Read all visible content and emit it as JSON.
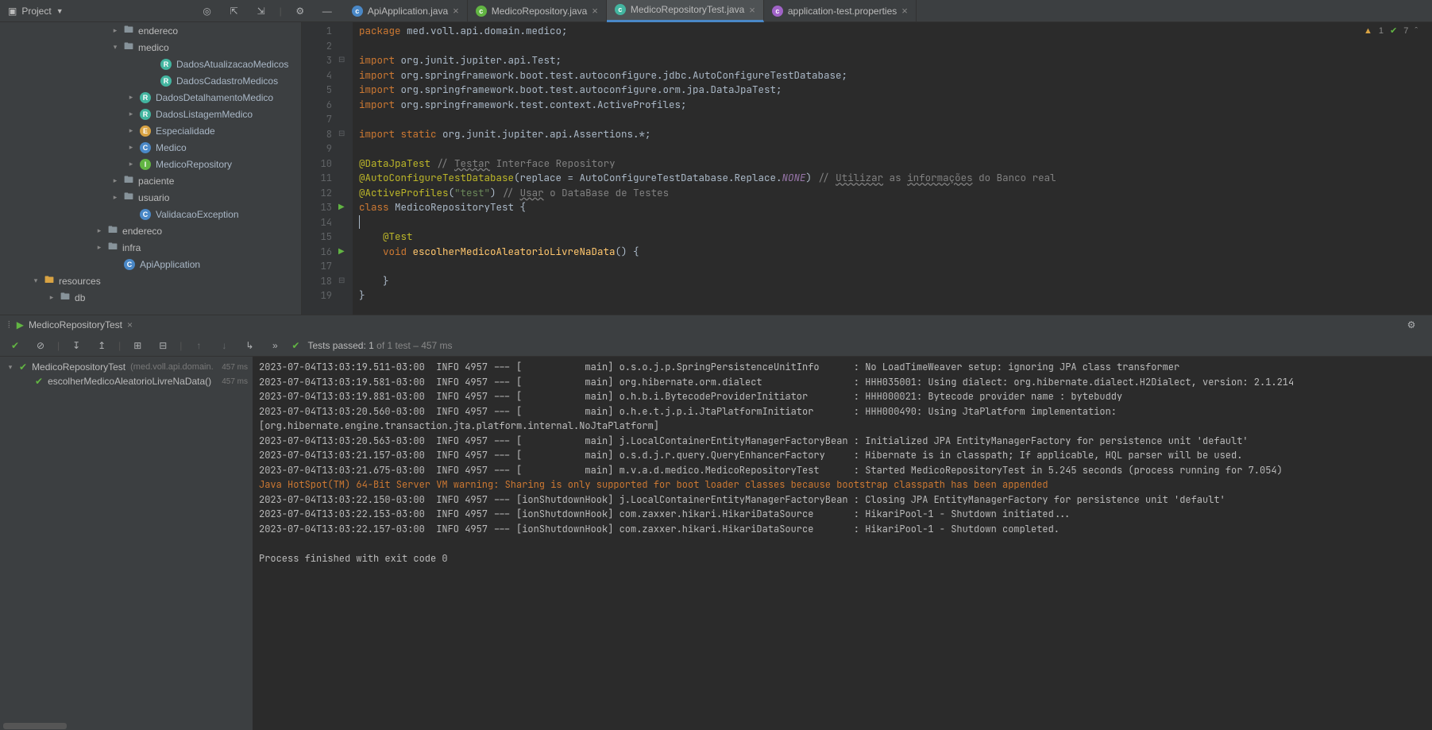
{
  "toolbar": {
    "project_label": "Project"
  },
  "tabs": [
    {
      "icon": "ic-blue",
      "label": "ApiApplication.java",
      "active": false
    },
    {
      "icon": "ic-green",
      "label": "MedicoRepository.java",
      "active": false
    },
    {
      "icon": "ic-teal",
      "label": "MedicoRepositoryTest.java",
      "active": true
    },
    {
      "icon": "ic-purp",
      "label": "application-test.properties",
      "active": false
    }
  ],
  "tree": [
    {
      "indent": 140,
      "chev": "▸",
      "type": "folder",
      "label": "endereco"
    },
    {
      "indent": 140,
      "chev": "▾",
      "type": "folder",
      "label": "medico"
    },
    {
      "indent": 186,
      "chev": "",
      "type": "rec",
      "label": "DadosAtualizacaoMedicos"
    },
    {
      "indent": 186,
      "chev": "",
      "type": "rec",
      "label": "DadosCadastroMedicos"
    },
    {
      "indent": 160,
      "chev": "▸",
      "type": "rec",
      "label": "DadosDetalhamentoMedico"
    },
    {
      "indent": 160,
      "chev": "▸",
      "type": "rec",
      "label": "DadosListagemMedico"
    },
    {
      "indent": 160,
      "chev": "▸",
      "type": "enum",
      "label": "Especialidade"
    },
    {
      "indent": 160,
      "chev": "▸",
      "type": "class",
      "label": "Medico"
    },
    {
      "indent": 160,
      "chev": "▸",
      "type": "iface",
      "label": "MedicoRepository"
    },
    {
      "indent": 140,
      "chev": "▸",
      "type": "folder",
      "label": "paciente"
    },
    {
      "indent": 140,
      "chev": "▸",
      "type": "folder",
      "label": "usuario"
    },
    {
      "indent": 160,
      "chev": "",
      "type": "class",
      "label": "ValidacaoException"
    },
    {
      "indent": 120,
      "chev": "▸",
      "type": "folder",
      "label": "endereco"
    },
    {
      "indent": 120,
      "chev": "▸",
      "type": "folder",
      "label": "infra"
    },
    {
      "indent": 140,
      "chev": "",
      "type": "class",
      "label": "ApiApplication"
    },
    {
      "indent": 40,
      "chev": "▾",
      "type": "resfolder",
      "label": "resources"
    },
    {
      "indent": 60,
      "chev": "▸",
      "type": "folder",
      "label": "db"
    }
  ],
  "warnings": {
    "warn_count": "1",
    "ok_count": "7"
  },
  "code_lines": [
    {
      "n": "1",
      "html": "<span class='kw'>package </span>med.voll.api.domain.medico;"
    },
    {
      "n": "2",
      "html": ""
    },
    {
      "n": "3",
      "html": "<span class='kw'>import </span>org.junit.jupiter.api.Test;",
      "fold": "⊟"
    },
    {
      "n": "4",
      "html": "<span class='kw'>import </span>org.springframework.boot.test.autoconfigure.jdbc.<span class='type'>AutoConfigureTestDatabase</span>;"
    },
    {
      "n": "5",
      "html": "<span class='kw'>import </span>org.springframework.boot.test.autoconfigure.orm.jpa.<span class='type'>DataJpaTest</span>;"
    },
    {
      "n": "6",
      "html": "<span class='kw'>import </span>org.springframework.test.context.<span class='type'>ActiveProfiles</span>;"
    },
    {
      "n": "7",
      "html": ""
    },
    {
      "n": "8",
      "html": "<span class='kw'>import static </span>org.junit.jupiter.api.Assertions.*;",
      "fold": "⊟"
    },
    {
      "n": "9",
      "html": ""
    },
    {
      "n": "10",
      "html": "<span class='ann'>@DataJpaTest</span> <span class='com'>// <span class='corr'>Testar</span> Interface Repository</span>"
    },
    {
      "n": "11",
      "html": "<span class='ann'>@AutoConfigureTestDatabase</span>(replace = AutoConfigureTestDatabase.Replace.<span style='color:#9876aa;font-style:italic'>NONE</span>) <span class='com'>// <span class='corr'>Utilizar</span> as <span class='corr'>informações</span> do Banco real</span>"
    },
    {
      "n": "12",
      "html": "<span class='ann'>@ActiveProfiles</span>(<span class='str'>\"test\"</span>) <span class='com'>// <span class='corr'>Usar</span> o DataBase de Testes</span>"
    },
    {
      "n": "13",
      "html": "<span class='kw'>class </span>MedicoRepositoryTest {",
      "run": true
    },
    {
      "n": "14",
      "html": "<span style='border-left:1px solid #a9b7c6;padding-left:1px'></span>"
    },
    {
      "n": "15",
      "html": "    <span class='ann'>@Test</span>"
    },
    {
      "n": "16",
      "html": "    <span class='kw'>void </span><span class='meth'>escolherMedicoAleatorioLivreNaData</span>() {",
      "run": true,
      "fold": "⊟"
    },
    {
      "n": "17",
      "html": ""
    },
    {
      "n": "18",
      "html": "    }",
      "fold": "⊟"
    },
    {
      "n": "19",
      "html": "}"
    }
  ],
  "run": {
    "tab_label": "MedicoRepositoryTest",
    "status": "Tests passed: 1",
    "status_tail": " of 1 test – 457 ms",
    "tests": [
      {
        "name": "MedicoRepositoryTest",
        "suffix": "(med.voll.api.domain.",
        "time": "457 ms",
        "chev": "▾"
      },
      {
        "name": "escolherMedicoAleatorioLivreNaData()",
        "suffix": "",
        "time": "457 ms",
        "chev": ""
      }
    ],
    "console": [
      {
        "t": "2023-07-04T13:03:19.511-03:00  INFO 4957 --- [           main] o.s.o.j.p.SpringPersistenceUnitInfo      : No LoadTimeWeaver setup: ignoring JPA class transformer"
      },
      {
        "t": "2023-07-04T13:03:19.581-03:00  INFO 4957 --- [           main] org.hibernate.orm.dialect                : HHH035001: Using dialect: org.hibernate.dialect.H2Dialect, version: 2.1.214"
      },
      {
        "t": "2023-07-04T13:03:19.881-03:00  INFO 4957 --- [           main] o.h.b.i.BytecodeProviderInitiator        : HHH000021: Bytecode provider name : bytebuddy"
      },
      {
        "t": "2023-07-04T13:03:20.560-03:00  INFO 4957 --- [           main] o.h.e.t.j.p.i.JtaPlatformInitiator       : HHH000490: Using JtaPlatform implementation: [org.hibernate.engine.transaction.jta.platform.internal.NoJtaPlatform]"
      },
      {
        "t": "2023-07-04T13:03:20.563-03:00  INFO 4957 --- [           main] j.LocalContainerEntityManagerFactoryBean : Initialized JPA EntityManagerFactory for persistence unit 'default'"
      },
      {
        "t": "2023-07-04T13:03:21.157-03:00  INFO 4957 --- [           main] o.s.d.j.r.query.QueryEnhancerFactory     : Hibernate is in classpath; If applicable, HQL parser will be used."
      },
      {
        "t": "2023-07-04T13:03:21.675-03:00  INFO 4957 --- [           main] m.v.a.d.medico.MedicoRepositoryTest      : Started MedicoRepositoryTest in 5.245 seconds (process running for 7.054)"
      },
      {
        "t": "Java HotSpot(TM) 64-Bit Server VM warning: Sharing is only supported for boot loader classes because bootstrap classpath has been appended",
        "warn": true
      },
      {
        "t": "2023-07-04T13:03:22.150-03:00  INFO 4957 --- [ionShutdownHook] j.LocalContainerEntityManagerFactoryBean : Closing JPA EntityManagerFactory for persistence unit 'default'"
      },
      {
        "t": "2023-07-04T13:03:22.153-03:00  INFO 4957 --- [ionShutdownHook] com.zaxxer.hikari.HikariDataSource       : HikariPool-1 - Shutdown initiated..."
      },
      {
        "t": "2023-07-04T13:03:22.157-03:00  INFO 4957 --- [ionShutdownHook] com.zaxxer.hikari.HikariDataSource       : HikariPool-1 - Shutdown completed."
      },
      {
        "t": ""
      },
      {
        "t": "Process finished with exit code 0"
      }
    ]
  }
}
